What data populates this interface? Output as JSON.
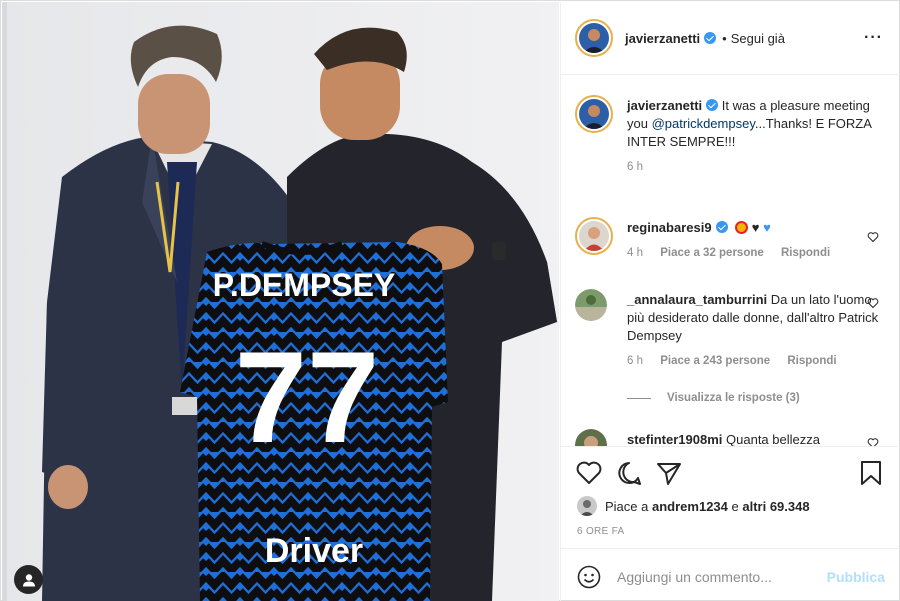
{
  "post": {
    "author": "javierzanetti",
    "follow_status": "Segui già",
    "caption": {
      "username": "javierzanetti",
      "text_1": "It was a pleasure meeting you",
      "mention": "@patrickdempsey",
      "text_2": "...Thanks! E FORZA INTER SEMPRE!!!",
      "time": "6 h"
    },
    "jersey": {
      "name": "P.DEMPSEY",
      "number": "77",
      "sponsor": "Driver"
    }
  },
  "comments": [
    {
      "username": "reginabaresi9",
      "text": "",
      "time": "4 h",
      "likes": "Piace a 32 persone",
      "reply": "Rispondi"
    },
    {
      "username": "_annalaura_tamburrini",
      "text": "Da un lato l'uomo più desiderato dalle donne, dall'altro Patrick Dempsey",
      "time": "6 h",
      "likes": "Piace a 243 persone",
      "reply": "Rispondi"
    },
    {
      "username": "stefinter1908mi",
      "text": "Quanta bellezza"
    }
  ],
  "view_replies": "Visualizza le risposte (3)",
  "likes": {
    "prefix": "Piace a",
    "user": "andrem1234",
    "middle": "e",
    "others": "altri 69.348"
  },
  "timestamp": "6 ORE FA",
  "add_comment": {
    "placeholder": "Aggiungi un commento...",
    "post_label": "Pubblica"
  },
  "colors": {
    "verified": "#3897f0",
    "inter_blue": "#1f6fd8",
    "inter_black": "#0e0e10",
    "link": "#00376b",
    "muted": "#8e8e8e",
    "post_disabled": "#b2dffc"
  },
  "icons": [
    "more-icon",
    "heart-icon",
    "comment-icon",
    "share-icon",
    "bookmark-icon",
    "emoji-icon",
    "user-tag-icon",
    "verified-icon"
  ]
}
